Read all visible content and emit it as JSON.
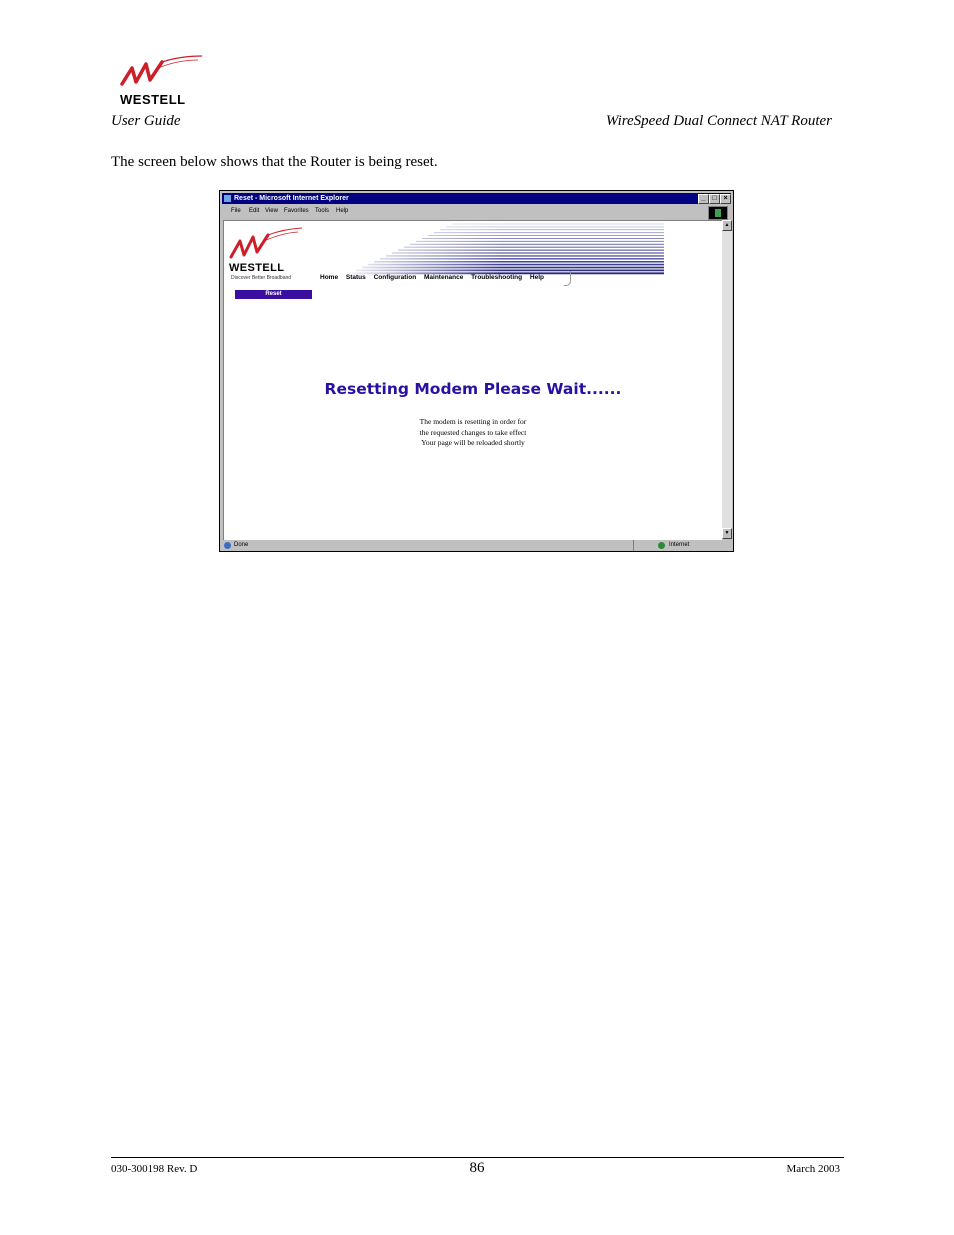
{
  "header": {
    "logo_text": "WESTELL",
    "left_title": "User Guide",
    "right_title": "WireSpeed Dual Connect NAT Router"
  },
  "intro_text": "The screen below shows that the Router is being reset.",
  "browser": {
    "title": "Reset - Microsoft Internet Explorer",
    "window_buttons": [
      "_",
      "□",
      "×"
    ],
    "menu": [
      "File",
      "Edit",
      "View",
      "Favorites",
      "Tools",
      "Help"
    ],
    "status_left": "Done",
    "status_right": "Internet",
    "page": {
      "brand": "WESTELL",
      "tagline": "Discover   Better   Broadband",
      "section_label": "Reset",
      "nav": [
        "Home",
        "Status",
        "Configuration",
        "Maintenance",
        "Troubleshooting",
        "Help"
      ],
      "wait_title": "Resetting Modem Please Wait......",
      "wait_lines": [
        "The modem is resetting in order for",
        "the requested changes to take effect",
        "Your page will be reloaded shortly"
      ]
    }
  },
  "footer": {
    "doc_number": "030-300198 Rev. D",
    "page_number": "86",
    "date": "March 2003"
  },
  "colors": {
    "brand_red": "#cc1f2a",
    "title_blue": "#2a12a0",
    "titlebar": "#000080"
  }
}
